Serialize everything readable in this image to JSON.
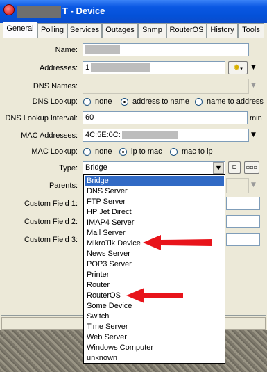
{
  "window": {
    "title_suffix": "T - Device"
  },
  "tabs": [
    "General",
    "Polling",
    "Services",
    "Outages",
    "Snmp",
    "RouterOS",
    "History",
    "Tools"
  ],
  "form": {
    "name_label": "Name:",
    "addresses_label": "Addresses:",
    "addresses_value_prefix": "1",
    "dns_names_label": "DNS Names:",
    "dns_lookup_label": "DNS Lookup:",
    "dns_lookup_options": [
      "none",
      "address to name",
      "name to address"
    ],
    "dns_lookup_selected": "address to name",
    "dns_lookup_interval_label": "DNS Lookup Interval:",
    "dns_lookup_interval_value": "60",
    "dns_lookup_interval_unit": "min",
    "mac_addresses_label": "MAC Addresses:",
    "mac_addresses_value": "4C:5E:0C:",
    "mac_lookup_label": "MAC Lookup:",
    "mac_lookup_options": [
      "none",
      "ip to mac",
      "mac to ip"
    ],
    "mac_lookup_selected": "ip to mac",
    "type_label": "Type:",
    "type_value": "Bridge",
    "type_btn_small": "▫",
    "type_btn_more": "▫▫▫",
    "parents_label": "Parents:",
    "custom_field_1_label": "Custom Field 1:",
    "custom_field_2_label": "Custom Field 2:",
    "custom_field_3_label": "Custom Field 3:"
  },
  "type_options": [
    "Bridge",
    "DNS Server",
    "FTP Server",
    "HP Jet Direct",
    "IMAP4 Server",
    "Mail Server",
    "MikroTik Device",
    "News Server",
    "POP3 Server",
    "Printer",
    "Router",
    "RouterOS",
    "Some Device",
    "Switch",
    "Time Server",
    "Web Server",
    "Windows Computer",
    "unknown"
  ],
  "type_selected_index": 0,
  "highlighted_options": [
    "MikroTik Device",
    "RouterOS"
  ],
  "icons": {
    "app": "mikrotik-dude-icon",
    "address_tool": "sun-icon",
    "dropdown": "triangle-down-icon"
  },
  "colors": {
    "titlebar": "#0451d8",
    "selection": "#316ac5",
    "arrow": "#e8141b"
  }
}
